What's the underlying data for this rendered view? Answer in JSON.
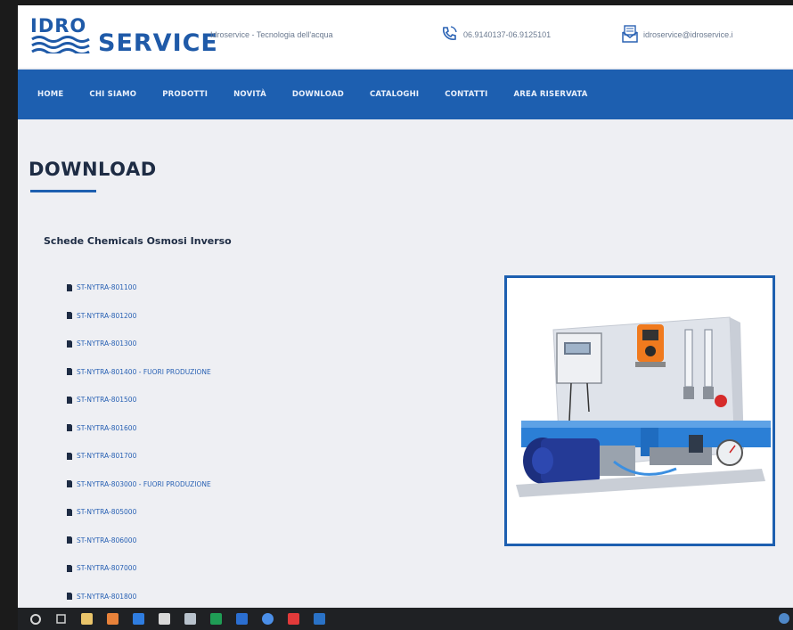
{
  "header": {
    "logo_top": "IDRO",
    "logo_bottom": "SERVICE",
    "tagline": "Idroservice - Tecnologia dell'acqua",
    "phone": "06.9140137-06.9125101",
    "email": "idroservice@idroservice.i"
  },
  "nav": {
    "items": [
      {
        "label": "HOME"
      },
      {
        "label": "CHI SIAMO"
      },
      {
        "label": "PRODOTTI"
      },
      {
        "label": "NOVITÀ"
      },
      {
        "label": "DOWNLOAD"
      },
      {
        "label": "CATALOGHI"
      },
      {
        "label": "CONTATTI"
      },
      {
        "label": "AREA RISERVATA"
      }
    ]
  },
  "main": {
    "title": "DOWNLOAD",
    "section_title": "Schede Chemicals Osmosi Inverso",
    "downloads": [
      {
        "label": "ST-NYTRA-801100"
      },
      {
        "label": "ST-NYTRA-801200"
      },
      {
        "label": "ST-NYTRA-801300"
      },
      {
        "label": "ST-NYTRA-801400 - FUORI PRODUZIONE"
      },
      {
        "label": "ST-NYTRA-801500"
      },
      {
        "label": "ST-NYTRA-801600"
      },
      {
        "label": "ST-NYTRA-801700"
      },
      {
        "label": "ST-NYTRA-803000 - FUORI PRODUZIONE"
      },
      {
        "label": "ST-NYTRA-805000"
      },
      {
        "label": "ST-NYTRA-806000"
      },
      {
        "label": "ST-NYTRA-807000"
      },
      {
        "label": "ST-NYTRA-801800"
      }
    ]
  },
  "colors": {
    "brand_blue": "#1d5fb0",
    "page_bg": "#eeeff3",
    "link": "#2a62b4",
    "heading": "#1e2c44"
  },
  "taskbar": {
    "icons": [
      "start-icon",
      "search-icon",
      "file-explorer-icon",
      "app-icon",
      "mail-icon",
      "browser-icon",
      "pen-icon",
      "excel-icon",
      "outlook-icon",
      "chrome-icon",
      "acrobat-icon",
      "app-icon"
    ]
  }
}
